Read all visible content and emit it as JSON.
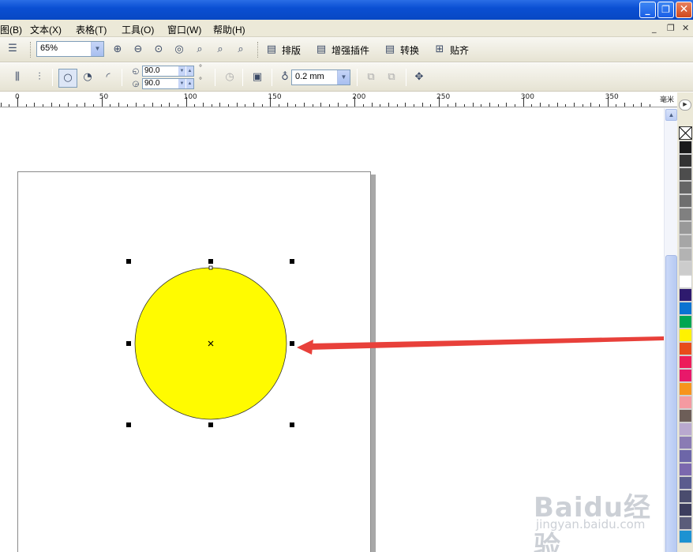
{
  "menu": {
    "items": [
      {
        "label": "图(B)"
      },
      {
        "label": "文本(X)"
      },
      {
        "label": "表格(T)"
      },
      {
        "label": "工具(O)"
      },
      {
        "label": "窗口(W)"
      },
      {
        "label": "帮助(H)"
      }
    ]
  },
  "toolbar1": {
    "zoom_value": "65%",
    "buttons": [
      "排版",
      "增强插件",
      "转换",
      "贴齐"
    ]
  },
  "toolbar2": {
    "start_angle": "90.0",
    "end_angle": "90.0",
    "outline_width": "0.2 mm"
  },
  "ruler": {
    "labels": [
      "0",
      "50",
      "100",
      "150",
      "200",
      "250",
      "300",
      "350"
    ],
    "unit": "毫米"
  },
  "watermark": {
    "brand": "Baidu经验",
    "url": "jingyan.baidu.com"
  },
  "colors": {
    "circle_fill": "#fffb00",
    "arrow": "#e8403a",
    "title_bar": "#0a4fd3"
  },
  "palette": [
    "#1a1a1a",
    "#333333",
    "#4d4d4d",
    "#666666",
    "#6f6f6f",
    "#808080",
    "#999999",
    "#a6a6a6",
    "#b3b3b3",
    "#cccccc",
    "#ffffff",
    "#2e1a6e",
    "#0a73d1",
    "#00a651",
    "#fff200",
    "#e84b1b",
    "#ed1c5a",
    "#e8186a",
    "#f7941d",
    "#f49aa1",
    "#6d5e58",
    "#b9a9cf",
    "#8a7bb4",
    "#6d66a8",
    "#7b68ae",
    "#5b5c8e",
    "#4a4c6e",
    "#3c3d5e",
    "#5a5c7a",
    "#1c92d2"
  ]
}
